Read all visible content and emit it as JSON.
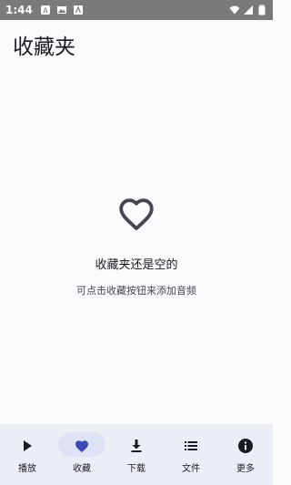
{
  "status_bar": {
    "time": "1:44",
    "left_icons": [
      "notification-a-icon",
      "image-icon",
      "notification-box-icon"
    ],
    "right_icons": [
      "wifi-icon",
      "cellular-signal-icon",
      "battery-icon"
    ]
  },
  "header": {
    "title": "收藏夹"
  },
  "empty_state": {
    "icon": "heart-outline-icon",
    "title": "收藏夹还是空的",
    "subtitle": "可点击收藏按钮来添加音频"
  },
  "bottom_nav": {
    "selected_index": 1,
    "colors": {
      "background": "#eceef6",
      "indicator": "#dde2f5",
      "active_icon": "#3c4bb3",
      "icon": "#1c1b1f"
    },
    "items": [
      {
        "label": "播放",
        "icon": "play-icon"
      },
      {
        "label": "收藏",
        "icon": "heart-filled-icon"
      },
      {
        "label": "下载",
        "icon": "download-icon"
      },
      {
        "label": "文件",
        "icon": "list-icon"
      },
      {
        "label": "更多",
        "icon": "info-icon"
      }
    ]
  }
}
